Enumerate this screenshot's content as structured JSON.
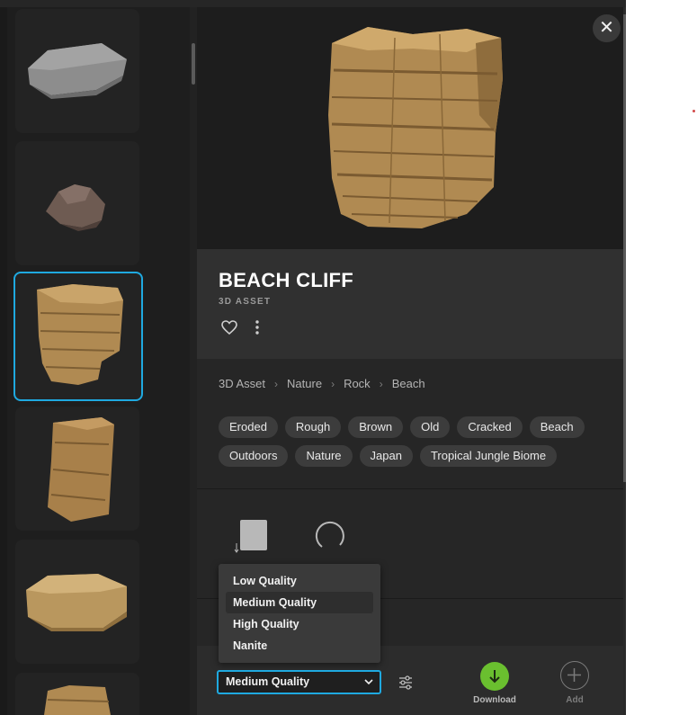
{
  "asset": {
    "title": "BEACH CLIFF",
    "type_label": "3D ASSET"
  },
  "breadcrumb": [
    "3D Asset",
    "Nature",
    "Rock",
    "Beach"
  ],
  "tags": [
    "Eroded",
    "Rough",
    "Brown",
    "Old",
    "Cracked",
    "Beach",
    "Outdoors",
    "Nature",
    "Japan",
    "Tropical Jungle Biome"
  ],
  "quality_menu": {
    "options": [
      "Low Quality",
      "Medium Quality",
      "High Quality",
      "Nanite"
    ],
    "highlighted_index": 1,
    "selected": "Medium Quality"
  },
  "actions": {
    "download_label": "Download",
    "add_label": "Add"
  },
  "icons": {
    "close": "close-icon",
    "favorite": "heart-icon",
    "more": "more-vertical-icon",
    "file_format": "file-format-icon",
    "loading": "spinner-icon",
    "settings": "sliders-icon",
    "download": "arrow-down-icon",
    "add": "plus-icon"
  },
  "colors": {
    "accent_blue": "#1fa9e0",
    "download_green": "#6abf2f",
    "panel_bg": "#262626",
    "rail_bg": "#1e1e1e"
  }
}
